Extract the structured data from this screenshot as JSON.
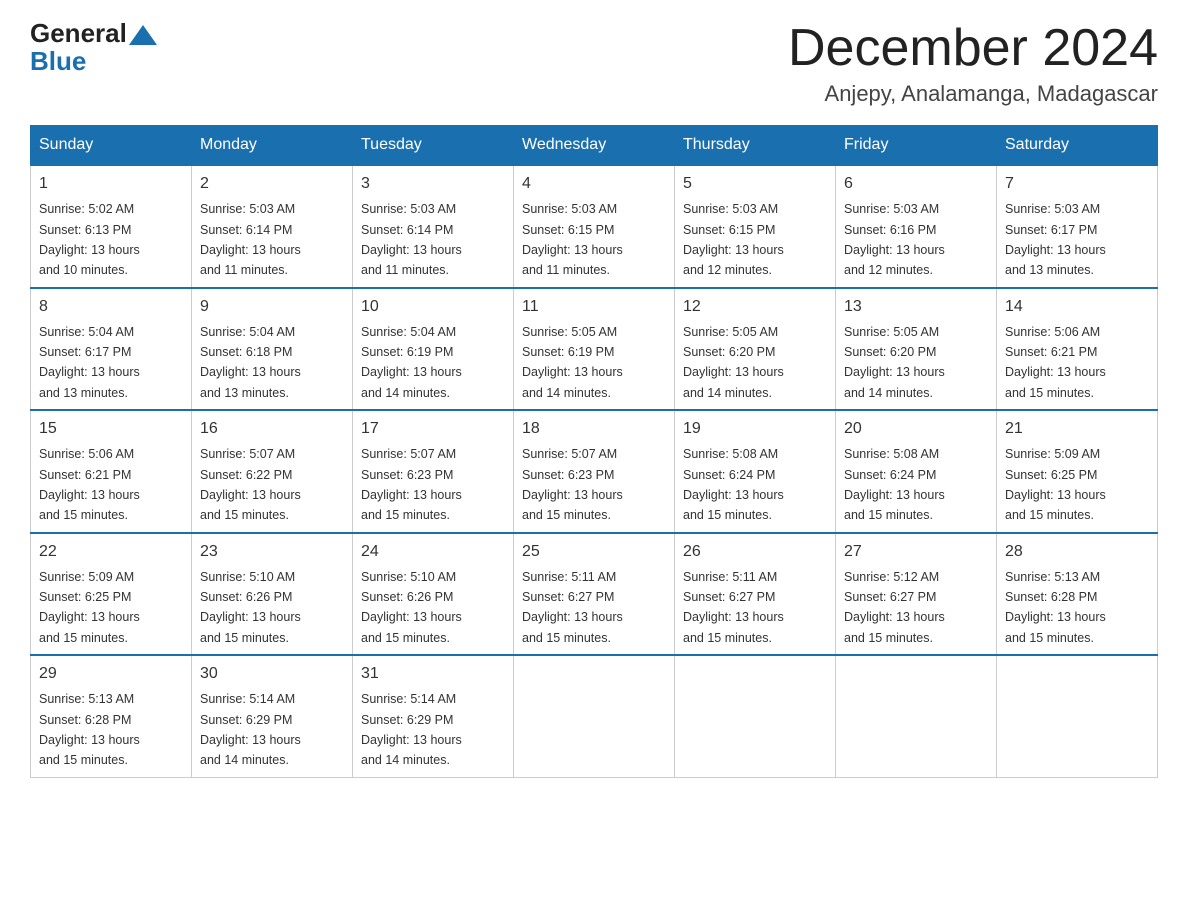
{
  "logo": {
    "general": "General",
    "blue": "Blue"
  },
  "title": "December 2024",
  "location": "Anjepy, Analamanga, Madagascar",
  "weekdays": [
    "Sunday",
    "Monday",
    "Tuesday",
    "Wednesday",
    "Thursday",
    "Friday",
    "Saturday"
  ],
  "weeks": [
    [
      {
        "day": "1",
        "sunrise": "5:02 AM",
        "sunset": "6:13 PM",
        "daylight": "13 hours and 10 minutes."
      },
      {
        "day": "2",
        "sunrise": "5:03 AM",
        "sunset": "6:14 PM",
        "daylight": "13 hours and 11 minutes."
      },
      {
        "day": "3",
        "sunrise": "5:03 AM",
        "sunset": "6:14 PM",
        "daylight": "13 hours and 11 minutes."
      },
      {
        "day": "4",
        "sunrise": "5:03 AM",
        "sunset": "6:15 PM",
        "daylight": "13 hours and 11 minutes."
      },
      {
        "day": "5",
        "sunrise": "5:03 AM",
        "sunset": "6:15 PM",
        "daylight": "13 hours and 12 minutes."
      },
      {
        "day": "6",
        "sunrise": "5:03 AM",
        "sunset": "6:16 PM",
        "daylight": "13 hours and 12 minutes."
      },
      {
        "day": "7",
        "sunrise": "5:03 AM",
        "sunset": "6:17 PM",
        "daylight": "13 hours and 13 minutes."
      }
    ],
    [
      {
        "day": "8",
        "sunrise": "5:04 AM",
        "sunset": "6:17 PM",
        "daylight": "13 hours and 13 minutes."
      },
      {
        "day": "9",
        "sunrise": "5:04 AM",
        "sunset": "6:18 PM",
        "daylight": "13 hours and 13 minutes."
      },
      {
        "day": "10",
        "sunrise": "5:04 AM",
        "sunset": "6:19 PM",
        "daylight": "13 hours and 14 minutes."
      },
      {
        "day": "11",
        "sunrise": "5:05 AM",
        "sunset": "6:19 PM",
        "daylight": "13 hours and 14 minutes."
      },
      {
        "day": "12",
        "sunrise": "5:05 AM",
        "sunset": "6:20 PM",
        "daylight": "13 hours and 14 minutes."
      },
      {
        "day": "13",
        "sunrise": "5:05 AM",
        "sunset": "6:20 PM",
        "daylight": "13 hours and 14 minutes."
      },
      {
        "day": "14",
        "sunrise": "5:06 AM",
        "sunset": "6:21 PM",
        "daylight": "13 hours and 15 minutes."
      }
    ],
    [
      {
        "day": "15",
        "sunrise": "5:06 AM",
        "sunset": "6:21 PM",
        "daylight": "13 hours and 15 minutes."
      },
      {
        "day": "16",
        "sunrise": "5:07 AM",
        "sunset": "6:22 PM",
        "daylight": "13 hours and 15 minutes."
      },
      {
        "day": "17",
        "sunrise": "5:07 AM",
        "sunset": "6:23 PM",
        "daylight": "13 hours and 15 minutes."
      },
      {
        "day": "18",
        "sunrise": "5:07 AM",
        "sunset": "6:23 PM",
        "daylight": "13 hours and 15 minutes."
      },
      {
        "day": "19",
        "sunrise": "5:08 AM",
        "sunset": "6:24 PM",
        "daylight": "13 hours and 15 minutes."
      },
      {
        "day": "20",
        "sunrise": "5:08 AM",
        "sunset": "6:24 PM",
        "daylight": "13 hours and 15 minutes."
      },
      {
        "day": "21",
        "sunrise": "5:09 AM",
        "sunset": "6:25 PM",
        "daylight": "13 hours and 15 minutes."
      }
    ],
    [
      {
        "day": "22",
        "sunrise": "5:09 AM",
        "sunset": "6:25 PM",
        "daylight": "13 hours and 15 minutes."
      },
      {
        "day": "23",
        "sunrise": "5:10 AM",
        "sunset": "6:26 PM",
        "daylight": "13 hours and 15 minutes."
      },
      {
        "day": "24",
        "sunrise": "5:10 AM",
        "sunset": "6:26 PM",
        "daylight": "13 hours and 15 minutes."
      },
      {
        "day": "25",
        "sunrise": "5:11 AM",
        "sunset": "6:27 PM",
        "daylight": "13 hours and 15 minutes."
      },
      {
        "day": "26",
        "sunrise": "5:11 AM",
        "sunset": "6:27 PM",
        "daylight": "13 hours and 15 minutes."
      },
      {
        "day": "27",
        "sunrise": "5:12 AM",
        "sunset": "6:27 PM",
        "daylight": "13 hours and 15 minutes."
      },
      {
        "day": "28",
        "sunrise": "5:13 AM",
        "sunset": "6:28 PM",
        "daylight": "13 hours and 15 minutes."
      }
    ],
    [
      {
        "day": "29",
        "sunrise": "5:13 AM",
        "sunset": "6:28 PM",
        "daylight": "13 hours and 15 minutes."
      },
      {
        "day": "30",
        "sunrise": "5:14 AM",
        "sunset": "6:29 PM",
        "daylight": "13 hours and 14 minutes."
      },
      {
        "day": "31",
        "sunrise": "5:14 AM",
        "sunset": "6:29 PM",
        "daylight": "13 hours and 14 minutes."
      },
      null,
      null,
      null,
      null
    ]
  ]
}
